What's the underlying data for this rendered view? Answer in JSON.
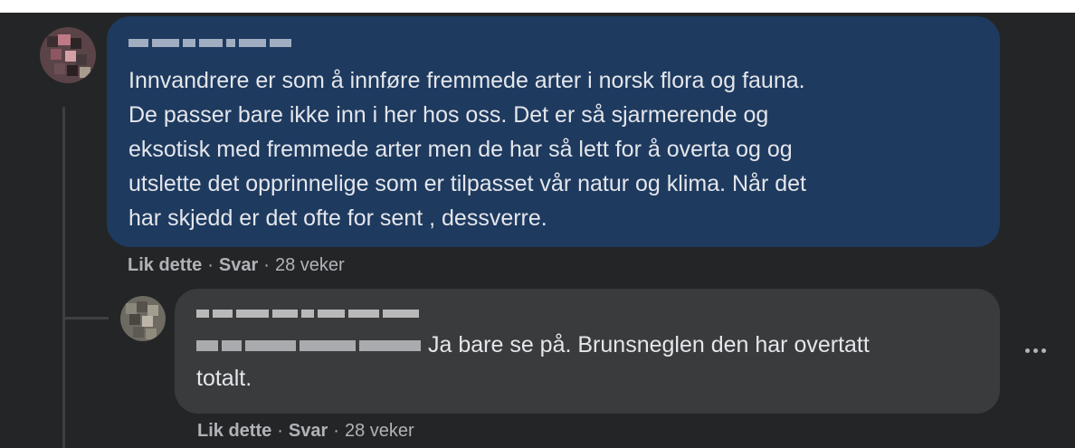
{
  "comments": [
    {
      "text": "Innvandrere er som å innføre fremmede arter i norsk flora og fauna.\nDe passer bare ikke inn i her hos oss. Det er så sjarmerende og\neksotisk med fremmede arter men de har så lett for å overta og og\nutslette det opprinnelige som er tilpasset vår natur og klima. Når det\nhar skjedd er det ofte for sent , dessverre.",
      "like_label": "Lik dette",
      "reply_label": "Svar",
      "separator": "·",
      "time": "28 veker"
    },
    {
      "text": "Ja bare se på. Brunsneglen den har overtatt\ntotalt.",
      "like_label": "Lik dette",
      "reply_label": "Svar",
      "separator": "·",
      "time": "28 veker"
    }
  ],
  "icons": {
    "more": "more-horizontal-icon"
  },
  "colors": {
    "background": "#242526",
    "highlighted_bubble": "#1e3a5f",
    "reply_bubble": "#3a3b3c",
    "text": "#e4e6eb",
    "meta_text": "#b0b3b8"
  }
}
